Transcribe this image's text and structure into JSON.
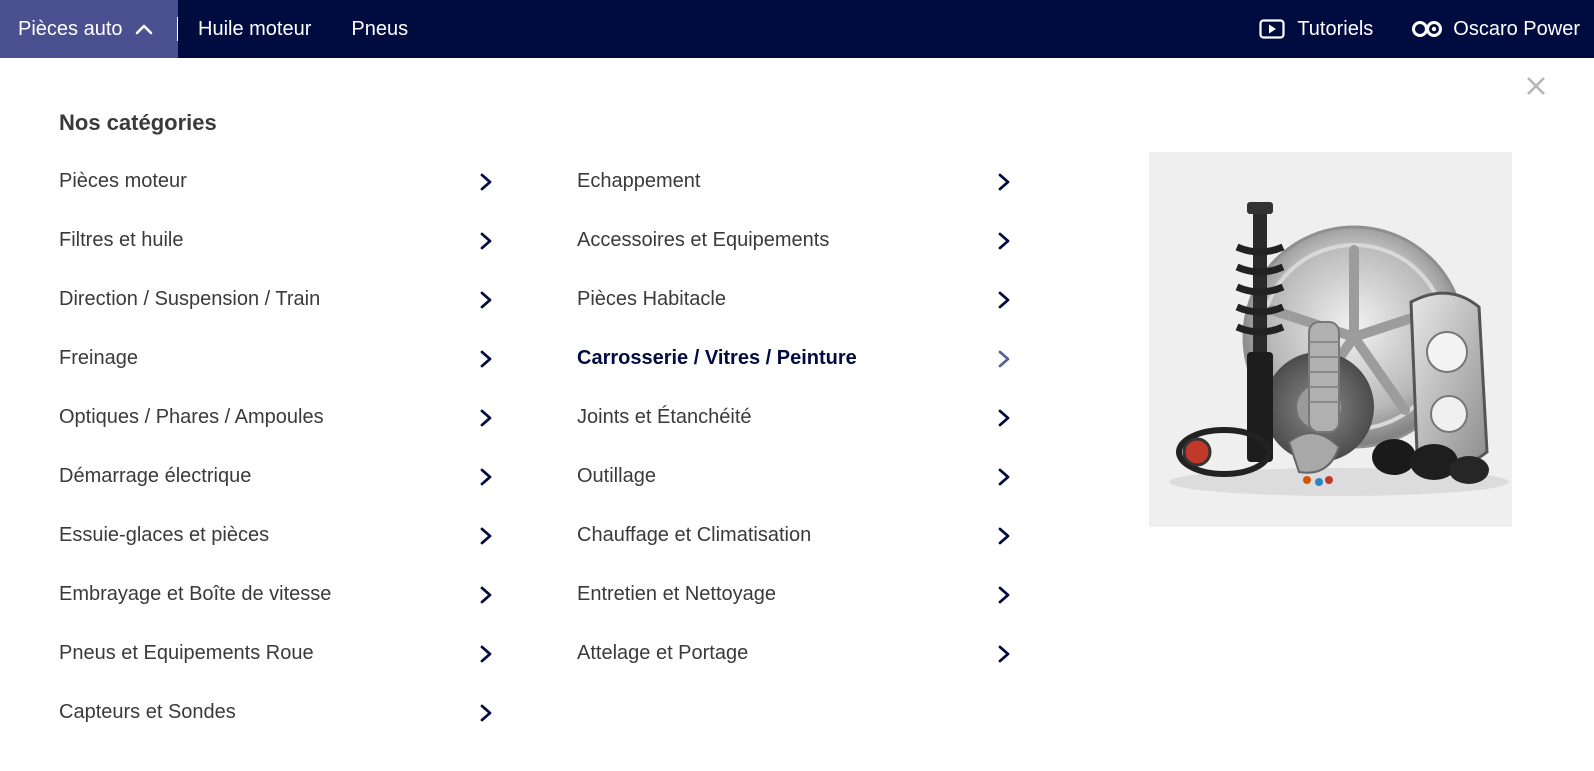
{
  "topnav": {
    "items": [
      {
        "label": "Pièces auto",
        "active": true
      },
      {
        "label": "Huile moteur"
      },
      {
        "label": "Pneus"
      }
    ],
    "right": [
      {
        "label": "Tutoriels",
        "icon": "play-video-icon"
      },
      {
        "label": "Oscaro Power",
        "icon": "oscaro-power-icon"
      }
    ]
  },
  "menu": {
    "title": "Nos catégories",
    "columns": [
      [
        {
          "label": "Pièces moteur"
        },
        {
          "label": "Filtres et huile"
        },
        {
          "label": "Direction / Suspension / Train"
        },
        {
          "label": "Freinage"
        },
        {
          "label": "Optiques / Phares / Ampoules"
        },
        {
          "label": "Démarrage électrique"
        },
        {
          "label": "Essuie-glaces et pièces"
        },
        {
          "label": "Embrayage et Boîte de vitesse"
        },
        {
          "label": "Pneus et Equipements Roue"
        },
        {
          "label": "Capteurs et Sondes"
        }
      ],
      [
        {
          "label": "Echappement"
        },
        {
          "label": "Accessoires et Equipements"
        },
        {
          "label": "Pièces Habitacle"
        },
        {
          "label": "Carrosserie / Vitres / Peinture",
          "hovered": true
        },
        {
          "label": "Joints et Étanchéité"
        },
        {
          "label": "Outillage"
        },
        {
          "label": "Chauffage et Climatisation"
        },
        {
          "label": "Entretien et Nettoyage"
        },
        {
          "label": "Attelage et Portage"
        }
      ]
    ]
  },
  "colors": {
    "topbar": "#000c40",
    "active_tab": "#4a508f",
    "chevron": "#000c40",
    "hover_chevron": "#5a5f9a",
    "text": "#3a3a3a"
  }
}
